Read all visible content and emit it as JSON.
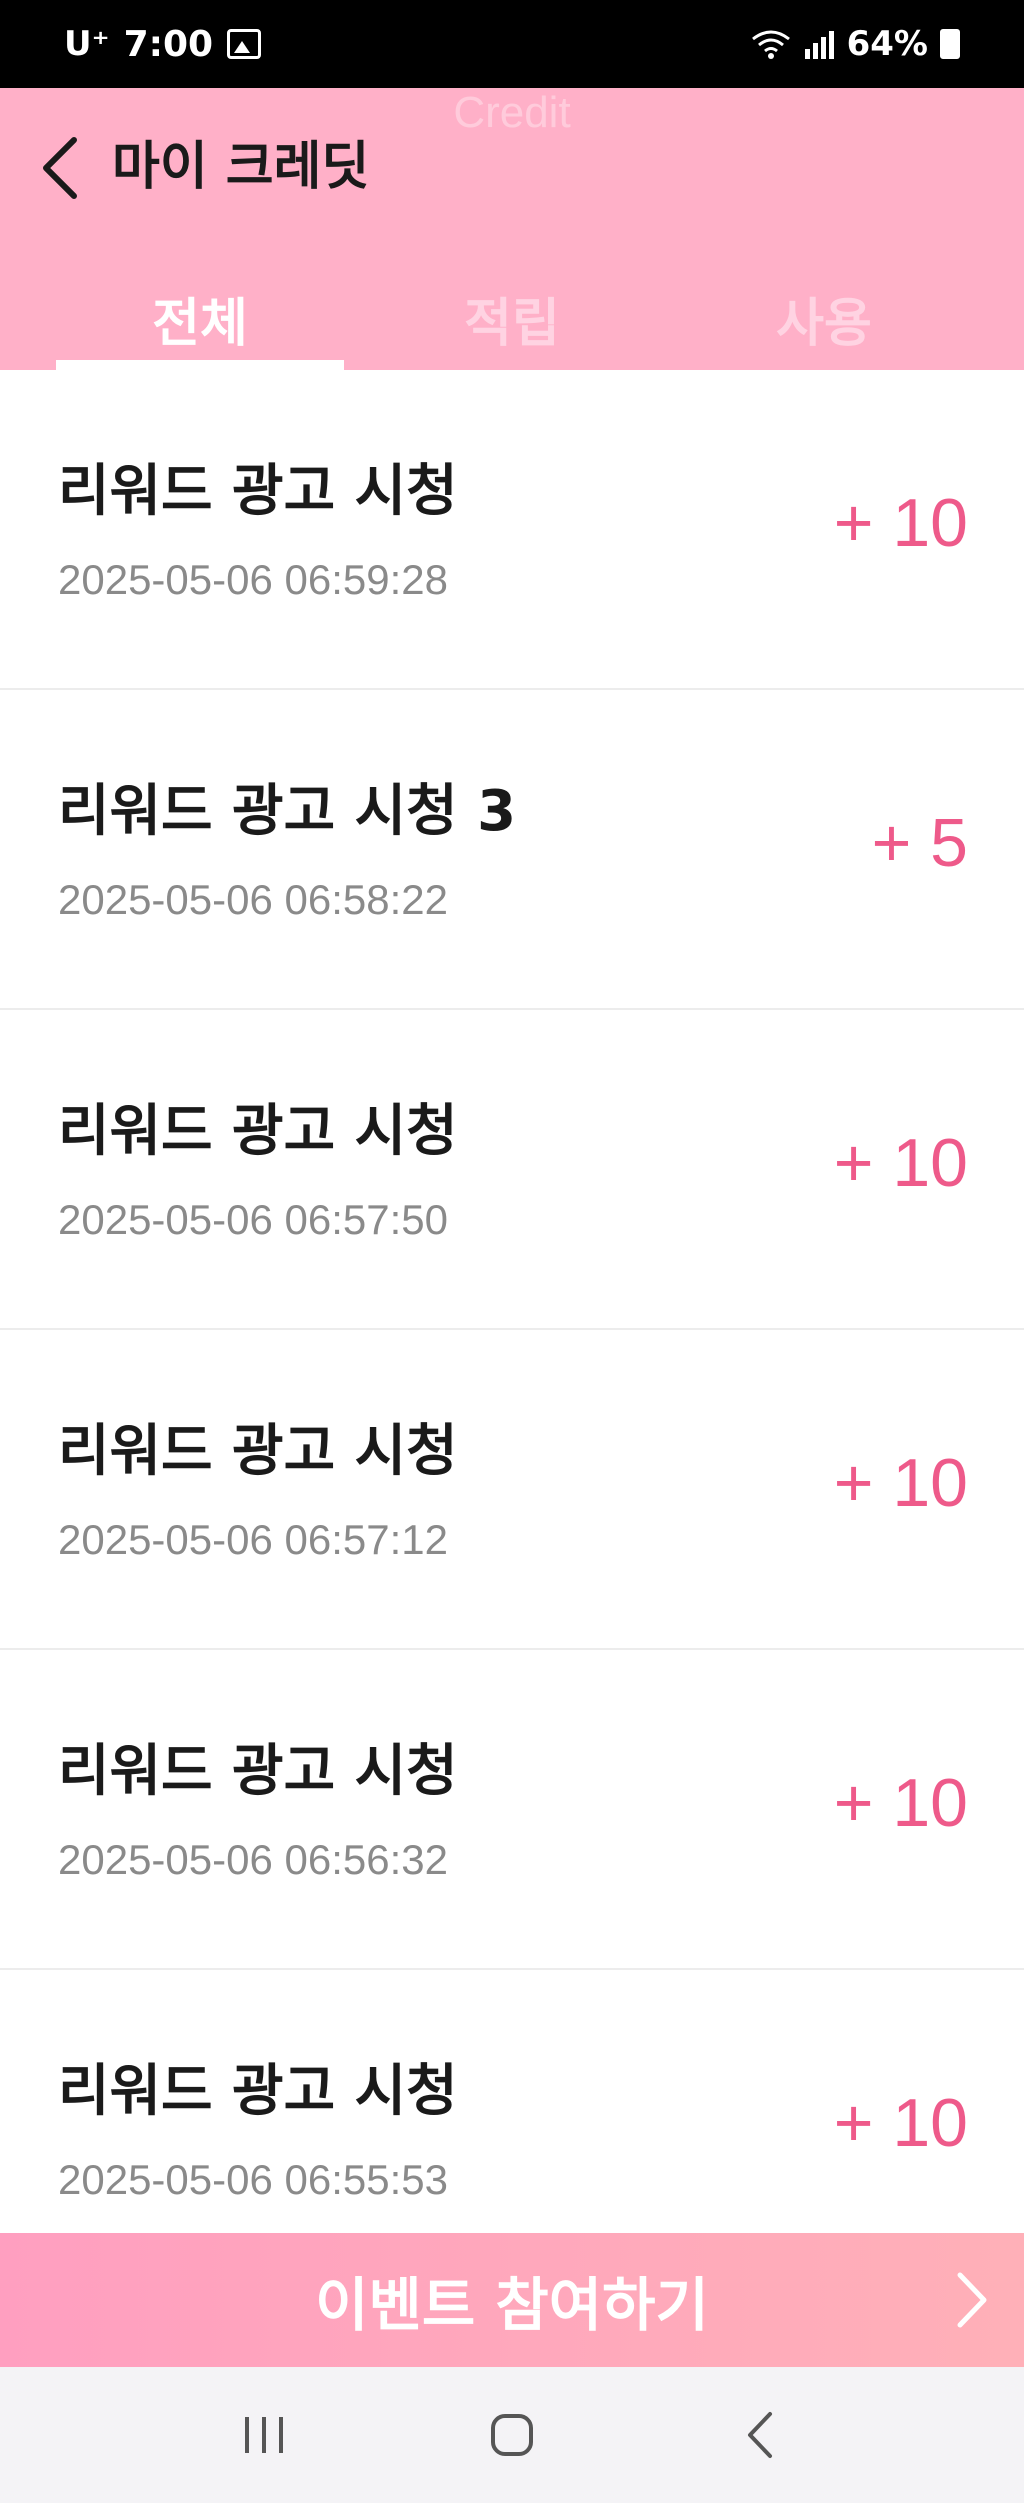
{
  "status_bar": {
    "carrier": "U⁺",
    "time": "7:00",
    "battery": "64%"
  },
  "header": {
    "ghost_text": "Credit",
    "title": "마이 크레딧",
    "back_icon": "chevron-left-icon"
  },
  "tabs": [
    {
      "label": "전체",
      "active": true
    },
    {
      "label": "적립",
      "active": false
    },
    {
      "label": "사용",
      "active": false
    }
  ],
  "items": [
    {
      "title": "리워드 광고 시청",
      "date": "2025-05-06 06:59:28",
      "amount": "+ 10"
    },
    {
      "title": "리워드 광고 시청 3",
      "date": "2025-05-06 06:58:22",
      "amount": "+ 5"
    },
    {
      "title": "리워드 광고 시청",
      "date": "2025-05-06 06:57:50",
      "amount": "+ 10"
    },
    {
      "title": "리워드 광고 시청",
      "date": "2025-05-06 06:57:12",
      "amount": "+ 10"
    },
    {
      "title": "리워드 광고 시청",
      "date": "2025-05-06 06:56:32",
      "amount": "+ 10"
    },
    {
      "title": "리워드 광고 시청",
      "date": "2025-05-06 06:55:53",
      "amount": "+ 10"
    }
  ],
  "event_bar": {
    "label": "이벤트 참여하기",
    "arrow_icon": "chevron-right-icon"
  },
  "colors": {
    "header": "#ffb0c8",
    "amount": "#ee5a8a",
    "event_start": "#ff9fc0",
    "event_end": "#ffb0b8"
  },
  "nav": {
    "recents_icon": "recents-icon",
    "home_icon": "home-icon",
    "back_icon": "back-icon"
  }
}
